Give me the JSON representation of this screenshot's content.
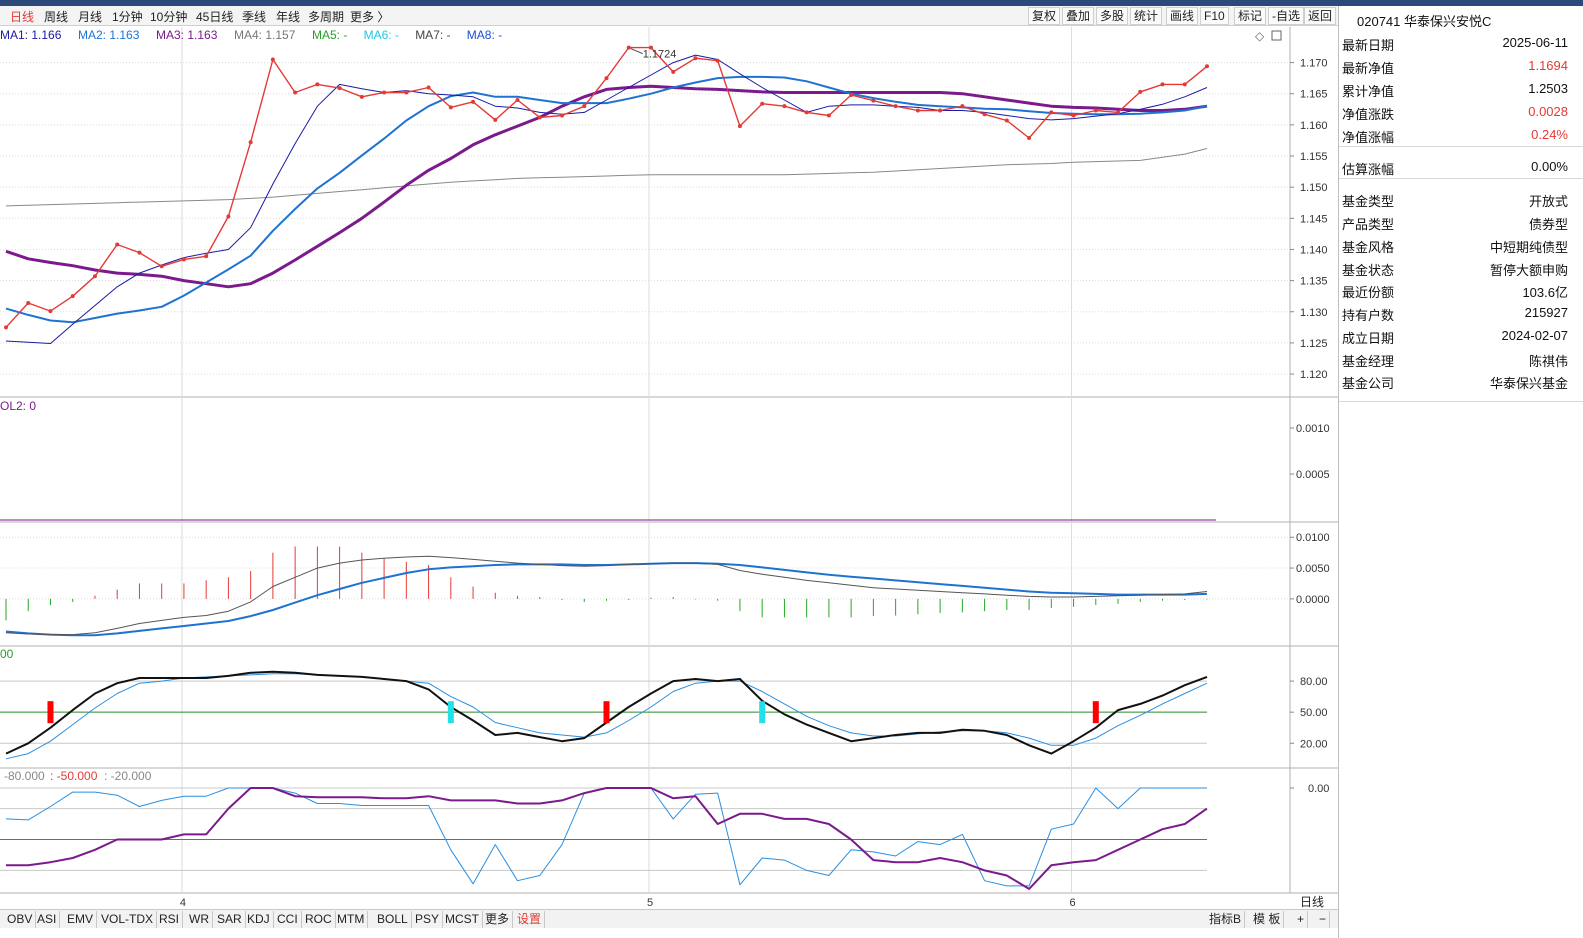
{
  "period_bar": {
    "items": [
      "日线",
      "周线",
      "月线",
      "1分钟",
      "10分钟",
      "45日线",
      "季线",
      "年线",
      "多周期",
      "更多 〉"
    ],
    "active_index": 0,
    "tools": [
      "复权",
      "叠加",
      "多股",
      "统计",
      "画线",
      "F10",
      "标记",
      "-自选",
      "返回"
    ]
  },
  "ma_legend": [
    {
      "text": "MA1: 1.166",
      "color": "#1a1aa6"
    },
    {
      "text": "MA2: 1.163",
      "color": "#1e73d2"
    },
    {
      "text": "MA3: 1.163",
      "color": "#7b1a8c"
    },
    {
      "text": "MA4: 1.157",
      "color": "#777777"
    },
    {
      "text": "MA5: -",
      "color": "#2a9d2a"
    },
    {
      "text": "MA6: -",
      "color": "#22c6e0"
    },
    {
      "text": "MA7: -",
      "color": "#444444"
    },
    {
      "text": "MA8: -",
      "color": "#1a4fd6"
    }
  ],
  "main_chart": {
    "y_ticks": [
      "1.170",
      "1.165",
      "1.160",
      "1.155",
      "1.150",
      "1.145",
      "1.140",
      "1.135",
      "1.130",
      "1.125",
      "1.120"
    ],
    "y_range": [
      1.1176,
      1.1725
    ],
    "peak_label": "1.1724",
    "nav": [
      1.1275,
      1.1314,
      1.1301,
      1.1325,
      1.1357,
      1.1408,
      1.1395,
      1.1373,
      1.1384,
      1.1389,
      1.1453,
      1.1572,
      1.1705,
      1.1652,
      1.1665,
      1.1659,
      1.1645,
      1.1652,
      1.1652,
      1.166,
      1.1628,
      1.1637,
      1.1608,
      1.164,
      1.1612,
      1.1615,
      1.163,
      1.1675,
      1.1724,
      1.1724,
      1.1685,
      1.1707,
      1.1703,
      1.1598,
      1.1634,
      1.163,
      1.162,
      1.1615,
      1.1648,
      1.1639,
      1.163,
      1.1623,
      1.1623,
      1.163,
      1.1617,
      1.1607,
      1.1579,
      1.162,
      1.1615,
      1.1623,
      1.162,
      1.1653,
      1.1665,
      1.1665,
      1.1694
    ],
    "ma1": [
      1.1253,
      1.1251,
      1.1249,
      1.128,
      1.131,
      1.134,
      1.1362,
      1.1375,
      1.1387,
      1.1394,
      1.14,
      1.1435,
      1.1505,
      1.157,
      1.163,
      1.1665,
      1.1658,
      1.1652,
      1.1655,
      1.165,
      1.1648,
      1.1645,
      1.163,
      1.1627,
      1.162,
      1.1617,
      1.162,
      1.164,
      1.166,
      1.168,
      1.17,
      1.1712,
      1.1705,
      1.1682,
      1.166,
      1.164,
      1.162,
      1.163,
      1.1632,
      1.1632,
      1.163,
      1.1628,
      1.1623,
      1.1623,
      1.162,
      1.1615,
      1.161,
      1.1608,
      1.161,
      1.1614,
      1.1618,
      1.1625,
      1.1633,
      1.1645,
      1.166
    ],
    "ma2": [
      1.1305,
      1.1295,
      1.1286,
      1.1283,
      1.129,
      1.1297,
      1.1302,
      1.1308,
      1.1326,
      1.1347,
      1.1368,
      1.139,
      1.143,
      1.1465,
      1.1498,
      1.1523,
      1.1551,
      1.1578,
      1.1607,
      1.163,
      1.1646,
      1.1652,
      1.1645,
      1.1645,
      1.164,
      1.1635,
      1.1635,
      1.1635,
      1.1642,
      1.165,
      1.166,
      1.1668,
      1.1675,
      1.1677,
      1.1677,
      1.1676,
      1.167,
      1.166,
      1.165,
      1.1643,
      1.1637,
      1.1632,
      1.163,
      1.1628,
      1.1626,
      1.1625,
      1.1622,
      1.1619,
      1.1618,
      1.1617,
      1.1617,
      1.1618,
      1.162,
      1.1623,
      1.163
    ],
    "ma3": [
      1.1397,
      1.1385,
      1.1379,
      1.1374,
      1.1367,
      1.1362,
      1.136,
      1.1357,
      1.135,
      1.1345,
      1.134,
      1.1345,
      1.1362,
      1.1383,
      1.1405,
      1.1427,
      1.145,
      1.1476,
      1.1503,
      1.1527,
      1.1546,
      1.1568,
      1.1584,
      1.1598,
      1.1612,
      1.163,
      1.1645,
      1.1657,
      1.166,
      1.1662,
      1.166,
      1.1658,
      1.1657,
      1.1655,
      1.1653,
      1.1652,
      1.1652,
      1.1652,
      1.1652,
      1.1652,
      1.1652,
      1.1652,
      1.1652,
      1.165,
      1.1645,
      1.164,
      1.1635,
      1.163,
      1.1628,
      1.1627,
      1.1625,
      1.1623,
      1.1623,
      1.1625,
      1.163
    ],
    "ma4": [
      1.147,
      1.1471,
      1.1472,
      1.1473,
      1.1474,
      1.1475,
      1.1476,
      1.1477,
      1.1478,
      1.1479,
      1.148,
      1.1482,
      1.1484,
      1.1487,
      1.149,
      1.1493,
      1.1496,
      1.1499,
      1.1502,
      1.1505,
      1.1508,
      1.151,
      1.1512,
      1.1514,
      1.1515,
      1.1516,
      1.1517,
      1.1518,
      1.1519,
      1.152,
      1.152,
      1.152,
      1.152,
      1.152,
      1.152,
      1.152,
      1.1521,
      1.1522,
      1.1523,
      1.1524,
      1.1526,
      1.1528,
      1.153,
      1.1532,
      1.1534,
      1.1536,
      1.1537,
      1.1538,
      1.154,
      1.1541,
      1.1542,
      1.1543,
      1.1548,
      1.1553,
      1.1562
    ]
  },
  "x_axis": {
    "labels": [
      {
        "text": "4",
        "index": 8
      },
      {
        "text": "5",
        "index": 29
      },
      {
        "text": "6",
        "index": 48
      }
    ],
    "period_label": "日线"
  },
  "vol_panel": {
    "legend": "OL2: 0",
    "y_ticks": [
      "0.0010",
      "0.0005"
    ],
    "y_range": [
      0,
      0.00125
    ]
  },
  "macd_panel": {
    "y_ticks": [
      "0.0100",
      "0.0050",
      "0.0000"
    ],
    "y_range": [
      -0.007,
      0.0115
    ],
    "dif": [
      -0.0055,
      -0.0057,
      -0.0058,
      -0.0058,
      -0.0055,
      -0.0048,
      -0.004,
      -0.0035,
      -0.003,
      -0.0027,
      -0.002,
      -0.0005,
      0.002,
      0.0035,
      0.005,
      0.0058,
      0.0063,
      0.0066,
      0.0068,
      0.0069,
      0.0067,
      0.0064,
      0.0061,
      0.0058,
      0.0056,
      0.0054,
      0.0053,
      0.0054,
      0.0056,
      0.0057,
      0.0058,
      0.0058,
      0.0056,
      0.0046,
      0.004,
      0.0035,
      0.003,
      0.0026,
      0.0022,
      0.0018,
      0.0016,
      0.0014,
      0.0012,
      0.001,
      0.0008,
      0.0006,
      0.0004,
      0.0003,
      0.0003,
      0.0004,
      0.0005,
      0.0006,
      0.0007,
      0.0008,
      0.0012
    ],
    "dea": [
      -0.0053,
      -0.0056,
      -0.0058,
      -0.0059,
      -0.0059,
      -0.0056,
      -0.0052,
      -0.0048,
      -0.0044,
      -0.004,
      -0.0036,
      -0.0028,
      -0.0018,
      -0.0006,
      0.0006,
      0.0016,
      0.0026,
      0.0034,
      0.0042,
      0.0048,
      0.0051,
      0.0053,
      0.0055,
      0.0056,
      0.0056,
      0.0056,
      0.0055,
      0.0055,
      0.0056,
      0.0057,
      0.0058,
      0.0058,
      0.0057,
      0.0055,
      0.0051,
      0.0047,
      0.0043,
      0.0039,
      0.0036,
      0.0033,
      0.003,
      0.0027,
      0.0024,
      0.0021,
      0.0018,
      0.0015,
      0.0012,
      0.001,
      0.0009,
      0.0008,
      0.0007,
      0.0007,
      0.0007,
      0.0007,
      0.0008
    ],
    "hist": [
      -0.0035,
      -0.002,
      -0.001,
      -0.0005,
      0.0005,
      0.0015,
      0.0025,
      0.0025,
      0.0025,
      0.003,
      0.0035,
      0.0045,
      0.0075,
      0.0085,
      0.0085,
      0.0085,
      0.0075,
      0.0065,
      0.006,
      0.0055,
      0.0035,
      0.002,
      0.001,
      0.0005,
      0.0003,
      -0.0002,
      -0.0005,
      -0.0003,
      -0.0002,
      0.0002,
      0.0003,
      -0.0001,
      -0.0003,
      -0.002,
      -0.003,
      -0.003,
      -0.003,
      -0.003,
      -0.003,
      -0.0028,
      -0.0027,
      -0.0025,
      -0.0023,
      -0.0022,
      -0.002,
      -0.0018,
      -0.0018,
      -0.0015,
      -0.0013,
      -0.001,
      -0.0008,
      -0.0005,
      -0.0003,
      -0.0002,
      -0.0001
    ]
  },
  "kdj_panel": {
    "legend": "00",
    "y_ticks": [
      "80.00",
      "50.00",
      "20.00"
    ],
    "y_range": [
      0,
      110
    ],
    "k": [
      10,
      20,
      35,
      52,
      68,
      78,
      83,
      83,
      83,
      83,
      85,
      88,
      89,
      88,
      86,
      85,
      84,
      82,
      80,
      72,
      55,
      42,
      28,
      30,
      26,
      22,
      25,
      40,
      55,
      68,
      80,
      82,
      80,
      82,
      61,
      48,
      38,
      30,
      22,
      25,
      28,
      30,
      30,
      33,
      32,
      28,
      18,
      10,
      22,
      35,
      52,
      58,
      66,
      76,
      84
    ],
    "d": [
      5,
      10,
      22,
      38,
      54,
      68,
      78,
      80,
      83,
      84,
      85,
      86,
      87,
      87,
      86,
      85,
      84,
      82,
      80,
      78,
      65,
      55,
      40,
      35,
      30,
      28,
      26,
      30,
      42,
      55,
      70,
      78,
      80,
      80,
      70,
      58,
      46,
      37,
      30,
      27,
      27,
      29,
      31,
      32,
      32,
      30,
      25,
      18,
      18,
      25,
      37,
      47,
      58,
      68,
      78
    ],
    "signals": [
      {
        "index": 2,
        "color": "#ff0000"
      },
      {
        "index": 20,
        "color": "#22e0e8"
      },
      {
        "index": 27,
        "color": "#ff0000"
      },
      {
        "index": 34,
        "color": "#22e0e8"
      },
      {
        "index": 49,
        "color": "#ff0000"
      }
    ]
  },
  "wr_panel": {
    "legend_prefix": "-80.000",
    "legend_mid": ": -50.000",
    "legend_suffix": ": -20.000",
    "y_ticks": [
      "0.00"
    ],
    "y_range": [
      -100,
      0
    ],
    "wr1": [
      -30,
      -31,
      -18,
      -4,
      -4,
      -7,
      -18,
      -12,
      -8,
      -8,
      0,
      0,
      0,
      -5,
      -15,
      -15,
      -17,
      -17,
      -17,
      -17,
      -60,
      -93,
      -55,
      -90,
      -85,
      -55,
      -5,
      0,
      0,
      0,
      -30,
      -6,
      -5,
      -94,
      -68,
      -70,
      -80,
      -85,
      -60,
      -62,
      -66,
      -52,
      -55,
      -45,
      -90,
      -95,
      -95,
      -40,
      -35,
      0,
      -20,
      0,
      0,
      0,
      0
    ],
    "wr2": [
      -75,
      -75,
      -72,
      -68,
      -60,
      -50,
      -50,
      -50,
      -45,
      -45,
      -20,
      0,
      0,
      -8,
      -9,
      -9,
      -9,
      -10,
      -10,
      -8,
      -12,
      -12,
      -12,
      -15,
      -15,
      -12,
      -5,
      0,
      0,
      0,
      -10,
      -8,
      -35,
      -25,
      -25,
      -30,
      -30,
      -35,
      -50,
      -70,
      -72,
      -72,
      -68,
      -72,
      -80,
      -85,
      -98,
      -75,
      -72,
      -70,
      -60,
      -50,
      -40,
      -35,
      -20
    ],
    "mid_level": -50
  },
  "bottom_tabs": {
    "items": [
      "OBV",
      "ASI",
      "EMV",
      "VOL-TDX",
      "RSI",
      "WR",
      "SAR",
      "KDJ",
      "CCI",
      "ROC",
      "MTM",
      "BOLL",
      "PSY",
      "MCST",
      "更多",
      "设置"
    ],
    "right_items": [
      "指标B",
      "模 板",
      "+",
      "−"
    ]
  },
  "fund_info": {
    "title": "020741 华泰保兴安悦C",
    "rows": [
      {
        "label": "最新日期",
        "value": "2025-06-11",
        "color": "#111111"
      },
      {
        "label": "最新净值",
        "value": "1.1694",
        "color": "#e53935"
      },
      {
        "label": "累计净值",
        "value": "1.2503",
        "color": "#111111"
      },
      {
        "label": "净值涨跌",
        "value": "0.0028",
        "color": "#e53935"
      },
      {
        "label": "净值涨幅",
        "value": "0.24%",
        "color": "#e53935"
      },
      {
        "label": "估算涨幅",
        "value": "0.00%",
        "color": "#111111"
      },
      {
        "label": "基金类型",
        "value": "开放式",
        "color": "#111111"
      },
      {
        "label": "产品类型",
        "value": "债券型",
        "color": "#111111"
      },
      {
        "label": "基金风格",
        "value": "中短期纯债型",
        "color": "#111111"
      },
      {
        "label": "基金状态",
        "value": "暂停大额申购",
        "color": "#111111"
      },
      {
        "label": "最近份额",
        "value": "103.6亿",
        "color": "#111111"
      },
      {
        "label": "持有户数",
        "value": "215927",
        "color": "#111111"
      },
      {
        "label": "成立日期",
        "value": "2024-02-07",
        "color": "#111111"
      },
      {
        "label": "基金经理",
        "value": "陈祺伟",
        "color": "#111111"
      },
      {
        "label": "基金公司",
        "value": "华泰保兴基金",
        "color": "#111111"
      }
    ]
  },
  "colors": {
    "nav_line": "#e53935",
    "ma1": "#1a1aa6",
    "ma2": "#1e73d2",
    "ma3": "#7b1a8c",
    "ma4": "#888888",
    "macd_up": "#e53935",
    "macd_down": "#22aa22",
    "grid": "#dcdcdc",
    "axis_text": "#333333"
  }
}
